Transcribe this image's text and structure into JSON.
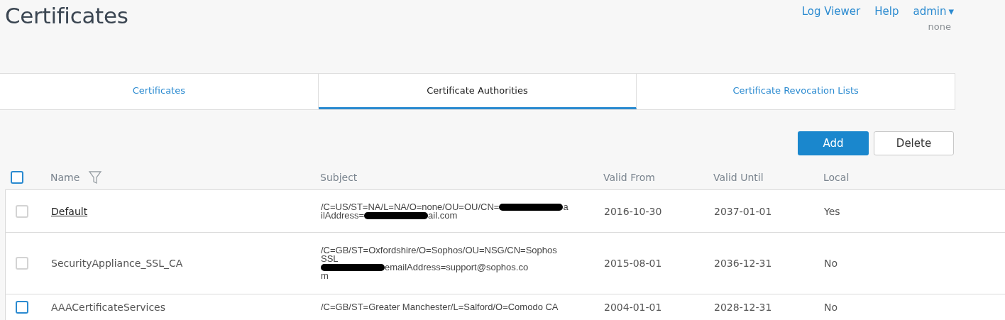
{
  "page": {
    "title": "Certificates"
  },
  "top_links": [
    {
      "label": "Log Viewer"
    },
    {
      "label": "Help"
    }
  ],
  "user_menu": {
    "label": "admin",
    "caret": "▾",
    "subtitle": "none"
  },
  "tabs": [
    {
      "label": "Certificates",
      "selected": false
    },
    {
      "label": "Certificate Authorities",
      "selected": true
    },
    {
      "label": "Certificate Revocation Lists",
      "selected": false
    }
  ],
  "actions": [
    {
      "label": "Add",
      "kind": "primary"
    },
    {
      "label": "Delete",
      "kind": "secondary"
    }
  ],
  "table": {
    "header_checkbox": {
      "checked": false,
      "focused": true
    },
    "columns": [
      "Name",
      "Subject",
      "Valid From",
      "Valid Until",
      "Local"
    ],
    "rows": [
      {
        "checked": false,
        "focused": false,
        "name": "Default",
        "link": true,
        "subject": [
          {
            "text": "/C=US/ST=NA/L=NA/O=none/OU=OU/CN=",
            "redacted": true,
            "after": "a"
          },
          {
            "text": "ilAddress=",
            "redacted": true,
            "after": "ail.com"
          }
        ],
        "valid_from": "2016-10-30",
        "valid_until": "2037-01-01",
        "local": "Yes"
      },
      {
        "checked": false,
        "focused": false,
        "name": "SecurityAppliance_SSL_CA",
        "link": false,
        "subject": [
          {
            "text": "/C=GB/ST=Oxfordshire/O=Sophos/OU=NSG/CN=Sophos",
            "redacted": false
          },
          {
            "text": "SSL",
            "redacted": false
          },
          {
            "redacted": true,
            "after": "emailAddress=support@sophos.co"
          },
          {
            "text": "m",
            "redacted": false
          }
        ],
        "valid_from": "2015-08-01",
        "valid_until": "2036-12-31",
        "local": "No"
      },
      {
        "checked": false,
        "focused": true,
        "name": "AAACertificateServices",
        "link": false,
        "subject": [
          {
            "text": "/C=GB/ST=Greater Manchester/L=Salford/O=Comodo CA",
            "redacted": false
          }
        ],
        "valid_from": "2004-01-01",
        "valid_until": "2028-12-31",
        "local": "No"
      }
    ]
  }
}
